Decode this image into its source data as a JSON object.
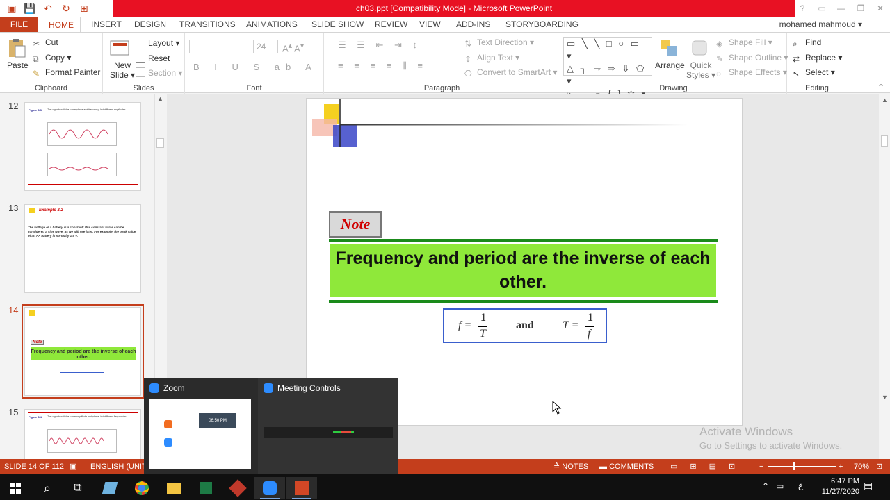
{
  "window": {
    "title": "ch03.ppt [Compatibility Mode] - Microsoft PowerPoint",
    "title_color": "#e81123",
    "accent": "#c43e1c"
  },
  "tabs": {
    "file": "FILE",
    "home": "HOME",
    "insert": "INSERT",
    "design": "DESIGN",
    "transitions": "TRANSITIONS",
    "animations": "ANIMATIONS",
    "slideshow": "SLIDE SHOW",
    "review": "REVIEW",
    "view": "VIEW",
    "addins": "ADD-INS",
    "storyboarding": "STORYBOARDING",
    "user": "mohamed mahmoud"
  },
  "ribbon": {
    "clipboard": {
      "paste": "Paste",
      "cut": "Cut",
      "copy": "Copy",
      "format_painter": "Format Painter",
      "label": "Clipboard"
    },
    "slides": {
      "new_slide_1": "New",
      "new_slide_2": "Slide",
      "layout": "Layout",
      "reset": "Reset",
      "section": "Section",
      "label": "Slides"
    },
    "font": {
      "size": "24",
      "label": "Font"
    },
    "paragraph": {
      "text_direction": "Text Direction",
      "align_text": "Align Text",
      "convert_smartart": "Convert to SmartArt",
      "label": "Paragraph"
    },
    "drawing": {
      "arrange": "Arrange",
      "quick_styles_1": "Quick",
      "quick_styles_2": "Styles",
      "shape_fill": "Shape Fill",
      "shape_outline": "Shape Outline",
      "shape_effects": "Shape Effects",
      "label": "Drawing"
    },
    "editing": {
      "find": "Find",
      "replace": "Replace",
      "select": "Select",
      "label": "Editing"
    }
  },
  "thumbnails": [
    {
      "num": "12",
      "title": "Figure 3.3",
      "caption": "Two signals with the same phase and frequency, but different amplitudes"
    },
    {
      "num": "13",
      "title": "Example 3.2",
      "body": "The voltage of a battery is a constant; this constant value can be considered a sine wave, as we will see later. For example, the peak value of an AA battery is normally 1.5 V."
    },
    {
      "num": "14",
      "note": "Note",
      "text": "Frequency and period are the inverse of each other."
    },
    {
      "num": "15",
      "title": "Figure 3.4",
      "caption": "Two signals with the same amplitude and phase, but different frequencies"
    }
  ],
  "slide": {
    "note_label": "Note",
    "main_text": "Frequency and period are the inverse of each other.",
    "formula_f": "f =",
    "formula_and": "and",
    "formula_T": "T =",
    "one": "1",
    "den_T": "T",
    "den_f": "f"
  },
  "watermark": {
    "line1": "Activate Windows",
    "line2": "Go to Settings to activate Windows."
  },
  "popup": {
    "zoom": "Zoom",
    "meeting_controls": "Meeting Controls",
    "clock_text": "06:50 PM"
  },
  "status": {
    "slide": "SLIDE 14 OF 112",
    "language": "ENGLISH (UNITE",
    "notes": "NOTES",
    "comments": "COMMENTS",
    "zoom": "70%"
  },
  "taskbar": {
    "lang": "ع",
    "time": "6:47 PM",
    "date": "11/27/2020"
  }
}
